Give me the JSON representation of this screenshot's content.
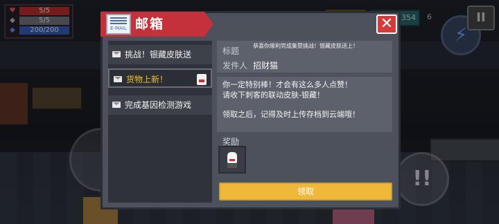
{
  "hud": {
    "hp": "5/5",
    "armor": "5/5",
    "energy": "200/200",
    "gems": "354",
    "enemy_count": "6"
  },
  "mailbox": {
    "title": "邮箱",
    "header_icon_text": "E-MAIL",
    "mails": [
      {
        "label": "挑战！银藏皮肤送"
      },
      {
        "label": "货物上新！"
      },
      {
        "label": "完成基因检测游戏"
      }
    ],
    "detail": {
      "subject_key": "标题",
      "subject_value": "恭喜你顺利完成集赞挑战！银藏皮肤送上！",
      "sender_key": "发件人",
      "sender_value": "招财猫",
      "body": [
        "你一定特别棒！才会有这么多人点赞！",
        "请收下刺客的联动皮肤-银藏！",
        "领取之后，记得及时上传存档到云端哦！"
      ],
      "reward_label": "奖励",
      "claim_label": "领取"
    }
  },
  "colors": {
    "header_red": "#c4313a",
    "claim_gold": "#f0b83a",
    "selected_text": "#f0c030"
  }
}
